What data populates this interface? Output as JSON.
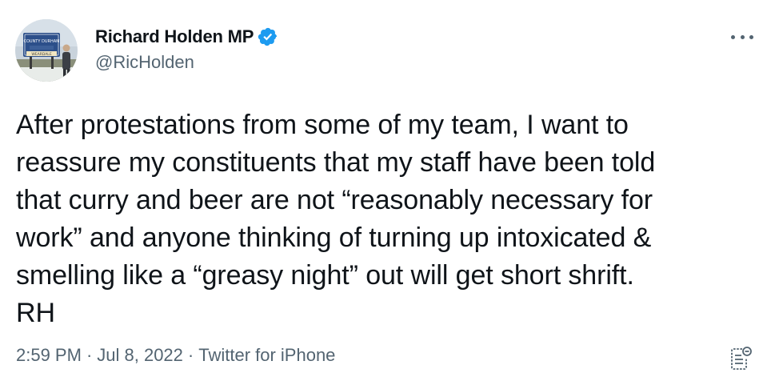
{
  "tweet": {
    "author": {
      "display_name": "Richard Holden MP",
      "handle": "@RicHolden",
      "verified": true,
      "avatar_sign_text": "COUNTY DURHAM",
      "avatar_sign_lower": "WEARDALE"
    },
    "text": "After protestations from some of my team, I want to\nreassure my constituents that my staff have been told\nthat curry and beer are not “reasonably necessary for\nwork” and anyone thinking of turning up intoxicated &\nsmelling like a “greasy night” out will get short shrift.\nRH",
    "time": "2:59 PM",
    "date": "Jul 8, 2022",
    "separator": "·",
    "source": "Twitter for iPhone"
  },
  "icons": {
    "more": "more-options-icon",
    "verified": "verified-badge-icon",
    "analytics": "tweet-analytics-icon"
  },
  "colors": {
    "text_primary": "#0f1419",
    "text_secondary": "#536471",
    "verified_blue": "#1d9bf0",
    "background": "#ffffff"
  }
}
